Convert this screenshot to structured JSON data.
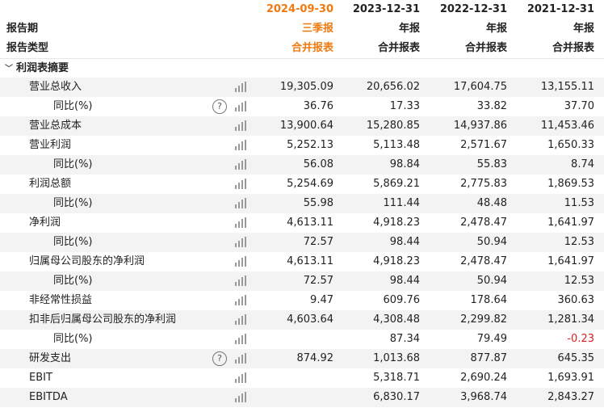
{
  "header": {
    "period_label": "报告期",
    "type_label": "报告类型",
    "columns": [
      {
        "date": "2024-09-30",
        "report": "三季报",
        "scope": "合并报表"
      },
      {
        "date": "2023-12-31",
        "report": "年报",
        "scope": "合并报表"
      },
      {
        "date": "2022-12-31",
        "report": "年报",
        "scope": "合并报表"
      },
      {
        "date": "2021-12-31",
        "report": "年报",
        "scope": "合并报表"
      }
    ]
  },
  "section": {
    "title": "利润表摘要",
    "collapse_icon": "chevron-down-icon"
  },
  "rows": [
    {
      "label": "营业总收入",
      "indent": 1,
      "help": false,
      "values": [
        "19,305.09",
        "20,656.02",
        "17,604.75",
        "13,155.11"
      ]
    },
    {
      "label": "同比(%)",
      "indent": 2,
      "help": true,
      "values": [
        "36.76",
        "17.33",
        "33.82",
        "37.70"
      ]
    },
    {
      "label": "营业总成本",
      "indent": 1,
      "help": false,
      "values": [
        "13,900.64",
        "15,280.85",
        "14,937.86",
        "11,453.46"
      ]
    },
    {
      "label": "营业利润",
      "indent": 1,
      "help": false,
      "values": [
        "5,252.13",
        "5,113.48",
        "2,571.67",
        "1,650.33"
      ]
    },
    {
      "label": "同比(%)",
      "indent": 2,
      "help": false,
      "values": [
        "56.08",
        "98.84",
        "55.83",
        "8.74"
      ]
    },
    {
      "label": "利润总额",
      "indent": 1,
      "help": false,
      "values": [
        "5,254.69",
        "5,869.21",
        "2,775.83",
        "1,869.53"
      ]
    },
    {
      "label": "同比(%)",
      "indent": 2,
      "help": false,
      "values": [
        "55.98",
        "111.44",
        "48.48",
        "11.53"
      ]
    },
    {
      "label": "净利润",
      "indent": 1,
      "help": false,
      "values": [
        "4,613.11",
        "4,918.23",
        "2,478.47",
        "1,641.97"
      ]
    },
    {
      "label": "同比(%)",
      "indent": 2,
      "help": false,
      "values": [
        "72.57",
        "98.44",
        "50.94",
        "12.53"
      ]
    },
    {
      "label": "归属母公司股东的净利润",
      "indent": 1,
      "help": false,
      "values": [
        "4,613.11",
        "4,918.23",
        "2,478.47",
        "1,641.97"
      ]
    },
    {
      "label": "同比(%)",
      "indent": 2,
      "help": false,
      "values": [
        "72.57",
        "98.44",
        "50.94",
        "12.53"
      ]
    },
    {
      "label": "非经常性损益",
      "indent": 1,
      "help": false,
      "values": [
        "9.47",
        "609.76",
        "178.64",
        "360.63"
      ]
    },
    {
      "label": "扣非后归属母公司股东的净利润",
      "indent": 1,
      "help": false,
      "values": [
        "4,603.64",
        "4,308.48",
        "2,299.82",
        "1,281.34"
      ]
    },
    {
      "label": "同比(%)",
      "indent": 2,
      "help": false,
      "values": [
        "",
        "87.34",
        "79.49",
        "-0.23"
      ]
    },
    {
      "label": "研发支出",
      "indent": 1,
      "help": true,
      "values": [
        "874.92",
        "1,013.68",
        "877.87",
        "645.35"
      ]
    },
    {
      "label": "EBIT",
      "indent": 1,
      "help": false,
      "values": [
        "",
        "5,318.71",
        "2,690.24",
        "1,693.91"
      ]
    },
    {
      "label": "EBITDA",
      "indent": 1,
      "help": false,
      "values": [
        "",
        "6,830.17",
        "3,968.74",
        "2,843.27"
      ]
    }
  ],
  "icons": {
    "chart": "bar-chart-icon",
    "help": "question-circle-icon"
  },
  "help_glyph": "?",
  "colors": {
    "accent": "#f07a10",
    "negative": "#e02020",
    "stripe": "#f3f3f3"
  }
}
